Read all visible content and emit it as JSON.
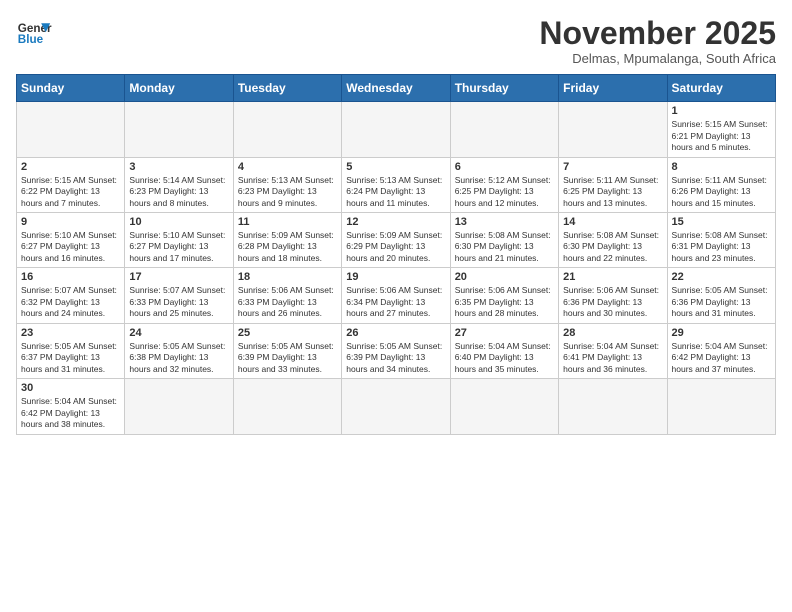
{
  "header": {
    "logo_line1": "General",
    "logo_line2": "Blue",
    "month_title": "November 2025",
    "subtitle": "Delmas, Mpumalanga, South Africa"
  },
  "weekdays": [
    "Sunday",
    "Monday",
    "Tuesday",
    "Wednesday",
    "Thursday",
    "Friday",
    "Saturday"
  ],
  "weeks": [
    [
      {
        "day": "",
        "info": ""
      },
      {
        "day": "",
        "info": ""
      },
      {
        "day": "",
        "info": ""
      },
      {
        "day": "",
        "info": ""
      },
      {
        "day": "",
        "info": ""
      },
      {
        "day": "",
        "info": ""
      },
      {
        "day": "1",
        "info": "Sunrise: 5:15 AM\nSunset: 6:21 PM\nDaylight: 13 hours and 5 minutes."
      }
    ],
    [
      {
        "day": "2",
        "info": "Sunrise: 5:15 AM\nSunset: 6:22 PM\nDaylight: 13 hours and 7 minutes."
      },
      {
        "day": "3",
        "info": "Sunrise: 5:14 AM\nSunset: 6:23 PM\nDaylight: 13 hours and 8 minutes."
      },
      {
        "day": "4",
        "info": "Sunrise: 5:13 AM\nSunset: 6:23 PM\nDaylight: 13 hours and 9 minutes."
      },
      {
        "day": "5",
        "info": "Sunrise: 5:13 AM\nSunset: 6:24 PM\nDaylight: 13 hours and 11 minutes."
      },
      {
        "day": "6",
        "info": "Sunrise: 5:12 AM\nSunset: 6:25 PM\nDaylight: 13 hours and 12 minutes."
      },
      {
        "day": "7",
        "info": "Sunrise: 5:11 AM\nSunset: 6:25 PM\nDaylight: 13 hours and 13 minutes."
      },
      {
        "day": "8",
        "info": "Sunrise: 5:11 AM\nSunset: 6:26 PM\nDaylight: 13 hours and 15 minutes."
      }
    ],
    [
      {
        "day": "9",
        "info": "Sunrise: 5:10 AM\nSunset: 6:27 PM\nDaylight: 13 hours and 16 minutes."
      },
      {
        "day": "10",
        "info": "Sunrise: 5:10 AM\nSunset: 6:27 PM\nDaylight: 13 hours and 17 minutes."
      },
      {
        "day": "11",
        "info": "Sunrise: 5:09 AM\nSunset: 6:28 PM\nDaylight: 13 hours and 18 minutes."
      },
      {
        "day": "12",
        "info": "Sunrise: 5:09 AM\nSunset: 6:29 PM\nDaylight: 13 hours and 20 minutes."
      },
      {
        "day": "13",
        "info": "Sunrise: 5:08 AM\nSunset: 6:30 PM\nDaylight: 13 hours and 21 minutes."
      },
      {
        "day": "14",
        "info": "Sunrise: 5:08 AM\nSunset: 6:30 PM\nDaylight: 13 hours and 22 minutes."
      },
      {
        "day": "15",
        "info": "Sunrise: 5:08 AM\nSunset: 6:31 PM\nDaylight: 13 hours and 23 minutes."
      }
    ],
    [
      {
        "day": "16",
        "info": "Sunrise: 5:07 AM\nSunset: 6:32 PM\nDaylight: 13 hours and 24 minutes."
      },
      {
        "day": "17",
        "info": "Sunrise: 5:07 AM\nSunset: 6:33 PM\nDaylight: 13 hours and 25 minutes."
      },
      {
        "day": "18",
        "info": "Sunrise: 5:06 AM\nSunset: 6:33 PM\nDaylight: 13 hours and 26 minutes."
      },
      {
        "day": "19",
        "info": "Sunrise: 5:06 AM\nSunset: 6:34 PM\nDaylight: 13 hours and 27 minutes."
      },
      {
        "day": "20",
        "info": "Sunrise: 5:06 AM\nSunset: 6:35 PM\nDaylight: 13 hours and 28 minutes."
      },
      {
        "day": "21",
        "info": "Sunrise: 5:06 AM\nSunset: 6:36 PM\nDaylight: 13 hours and 30 minutes."
      },
      {
        "day": "22",
        "info": "Sunrise: 5:05 AM\nSunset: 6:36 PM\nDaylight: 13 hours and 31 minutes."
      }
    ],
    [
      {
        "day": "23",
        "info": "Sunrise: 5:05 AM\nSunset: 6:37 PM\nDaylight: 13 hours and 31 minutes."
      },
      {
        "day": "24",
        "info": "Sunrise: 5:05 AM\nSunset: 6:38 PM\nDaylight: 13 hours and 32 minutes."
      },
      {
        "day": "25",
        "info": "Sunrise: 5:05 AM\nSunset: 6:39 PM\nDaylight: 13 hours and 33 minutes."
      },
      {
        "day": "26",
        "info": "Sunrise: 5:05 AM\nSunset: 6:39 PM\nDaylight: 13 hours and 34 minutes."
      },
      {
        "day": "27",
        "info": "Sunrise: 5:04 AM\nSunset: 6:40 PM\nDaylight: 13 hours and 35 minutes."
      },
      {
        "day": "28",
        "info": "Sunrise: 5:04 AM\nSunset: 6:41 PM\nDaylight: 13 hours and 36 minutes."
      },
      {
        "day": "29",
        "info": "Sunrise: 5:04 AM\nSunset: 6:42 PM\nDaylight: 13 hours and 37 minutes."
      }
    ],
    [
      {
        "day": "30",
        "info": "Sunrise: 5:04 AM\nSunset: 6:42 PM\nDaylight: 13 hours and 38 minutes."
      },
      {
        "day": "",
        "info": ""
      },
      {
        "day": "",
        "info": ""
      },
      {
        "day": "",
        "info": ""
      },
      {
        "day": "",
        "info": ""
      },
      {
        "day": "",
        "info": ""
      },
      {
        "day": "",
        "info": ""
      }
    ]
  ]
}
